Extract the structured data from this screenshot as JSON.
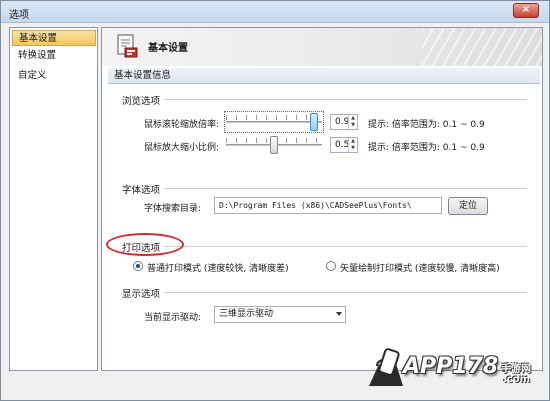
{
  "window": {
    "title": "选项",
    "close_glyph": "×"
  },
  "sidebar": {
    "items": [
      {
        "label": "基本设置",
        "active": true
      },
      {
        "label": "转换设置",
        "active": false
      },
      {
        "label": "自定义",
        "active": false
      }
    ]
  },
  "header": {
    "title": "基本设置",
    "icon": "settings-document-icon"
  },
  "section": {
    "title": "基本设置信息"
  },
  "browse": {
    "group_label": "浏览选项",
    "wheel_zoom": {
      "label": "鼠标滚轮缩放倍率:",
      "value": "0.9",
      "slider_level": 0.95,
      "hint": "提示: 倍率范围为: 0.1 ~ 0.9"
    },
    "zoom_ratio": {
      "label": "鼠标放大缩小比例:",
      "value": "0.5",
      "slider_level": 0.5,
      "hint": "提示: 倍率范围为: 0.1 ~ 0.9"
    }
  },
  "fonts": {
    "group_label": "字体选项",
    "search_label": "字体搜索目录:",
    "search_path": "D:\\Program Files (x86)\\CADSeePlus\\Fonts\\",
    "locate_button": "定位"
  },
  "print": {
    "group_label": "打印选项",
    "options": [
      {
        "label": "普通打印模式 (速度较快, 清晰度差)",
        "checked": true
      },
      {
        "label": "矢量绘制打印模式 (速度较慢, 清晰度高)",
        "checked": false
      }
    ]
  },
  "display": {
    "group_label": "显示选项",
    "driver_label": "当前显示驱动:",
    "driver_value": "三维显示驱动"
  },
  "watermark": {
    "brand": "APP178",
    "sub": "手游网",
    "domain": ".com"
  },
  "colors": {
    "annotation": "#d12b2b",
    "active_item": "#f0c564",
    "slider_focus": "#8fd0f2"
  }
}
